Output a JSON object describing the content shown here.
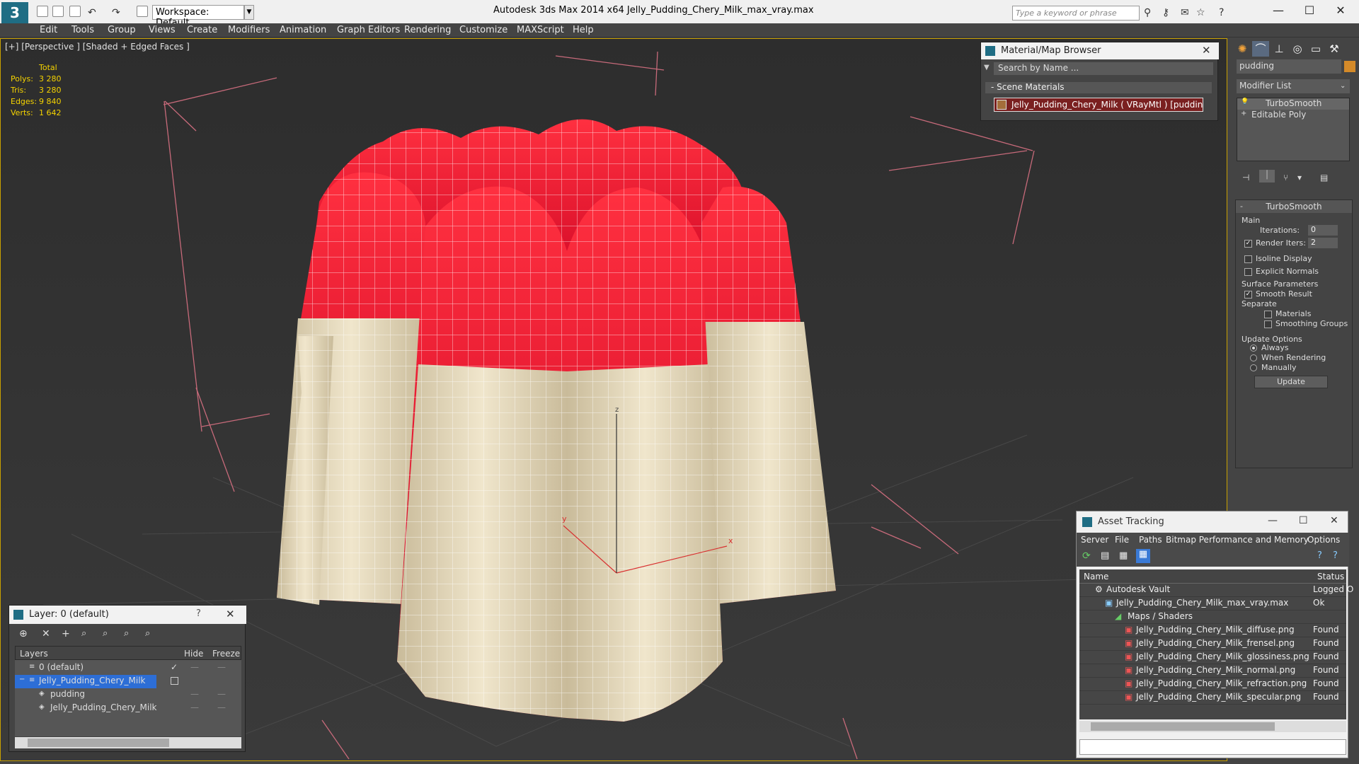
{
  "titlebar": {
    "app_title": "Autodesk 3ds Max  2014 x64      Jelly_Pudding_Chery_Milk_max_vray.max",
    "workspace": "Workspace: Default",
    "search_placeholder": "Type a keyword or phrase"
  },
  "menu": [
    "Edit",
    "Tools",
    "Group",
    "Views",
    "Create",
    "Modifiers",
    "Animation",
    "Graph Editors",
    "Rendering",
    "Customize",
    "MAXScript",
    "Help"
  ],
  "viewport": {
    "label": "[+] [Perspective ] [Shaded + Edged Faces ]",
    "stats": {
      "header": "Total",
      "rows": [
        {
          "label": "Polys:",
          "value": "3 280"
        },
        {
          "label": "Tris:",
          "value": "3 280"
        },
        {
          "label": "Edges:",
          "value": "9 840"
        },
        {
          "label": "Verts:",
          "value": "1 642"
        }
      ]
    },
    "axis_x": "x",
    "axis_y": "y",
    "axis_z": "z",
    "colors": {
      "jelly": "#e8102e",
      "cream": "#e8dcc0",
      "grid": "#555555",
      "bbox": "#c76a7a"
    }
  },
  "material_browser": {
    "title": "Material/Map Browser",
    "search": "Search by Name ...",
    "section": "- Scene Materials",
    "item": "Jelly_Pudding_Chery_Milk  ( VRayMtl )  [pudding]"
  },
  "command_panel": {
    "object_name": "pudding",
    "modifier_list": "Modifier List",
    "stack": [
      "TurboSmooth",
      "Editable Poly"
    ],
    "turbosmooth": {
      "title": "TurboSmooth",
      "main": "Main",
      "iterations_label": "Iterations:",
      "iterations": "0",
      "render_iters_label": "Render Iters:",
      "render_iters": "2",
      "isoline": "Isoline Display",
      "explicit": "Explicit Normals",
      "surface": "Surface Parameters",
      "smooth": "Smooth Result",
      "separate": "Separate",
      "materials": "Materials",
      "smoothing": "Smoothing Groups",
      "update_options": "Update Options",
      "always": "Always",
      "when_rendering": "When Rendering",
      "manually": "Manually",
      "update_btn": "Update"
    }
  },
  "layers": {
    "title": "Layer: 0 (default)",
    "help": "?",
    "col_layers": "Layers",
    "col_hide": "Hide",
    "col_freeze": "Freeze",
    "rows": [
      "0 (default)",
      "Jelly_Pudding_Chery_Milk",
      "pudding",
      "Jelly_Pudding_Chery_Milk"
    ]
  },
  "asset_tracking": {
    "title": "Asset Tracking",
    "menu": [
      "Server",
      "File",
      "Paths",
      "Bitmap Performance and Memory",
      "Options"
    ],
    "col_name": "Name",
    "col_status": "Status",
    "rows": [
      {
        "name": "Autodesk Vault",
        "status": "Logged O"
      },
      {
        "name": "Jelly_Pudding_Chery_Milk_max_vray.max",
        "status": "Ok"
      },
      {
        "name": "Maps / Shaders",
        "status": ""
      },
      {
        "name": "Jelly_Pudding_Chery_Milk_diffuse.png",
        "status": "Found"
      },
      {
        "name": "Jelly_Pudding_Chery_Milk_frensel.png",
        "status": "Found"
      },
      {
        "name": "Jelly_Pudding_Chery_Milk_glossiness.png",
        "status": "Found"
      },
      {
        "name": "Jelly_Pudding_Chery_Milk_normal.png",
        "status": "Found"
      },
      {
        "name": "Jelly_Pudding_Chery_Milk_refraction.png",
        "status": "Found"
      },
      {
        "name": "Jelly_Pudding_Chery_Milk_specular.png",
        "status": "Found"
      }
    ]
  }
}
